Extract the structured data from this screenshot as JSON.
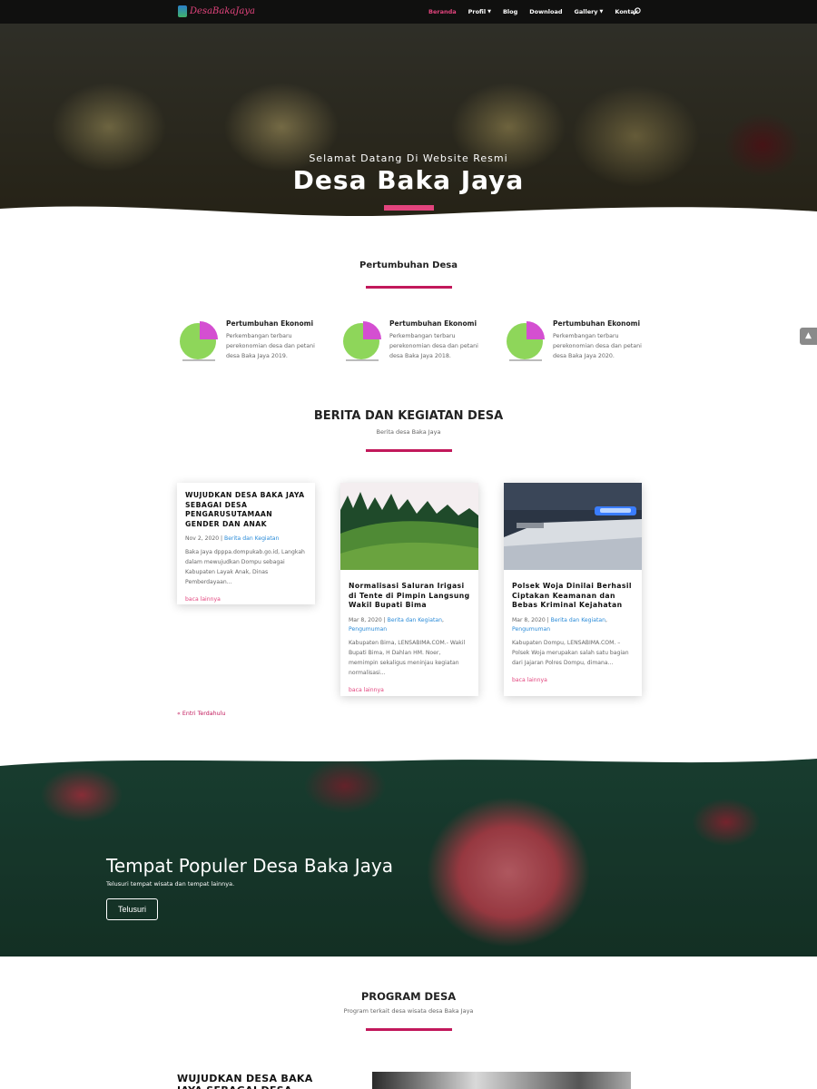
{
  "nav": {
    "logo": "DesaBakaJaya",
    "items": [
      {
        "label": "Beranda",
        "dropdown": false,
        "active": true
      },
      {
        "label": "Profil",
        "dropdown": true,
        "active": false
      },
      {
        "label": "Blog",
        "dropdown": false,
        "active": false
      },
      {
        "label": "Download",
        "dropdown": false,
        "active": false
      },
      {
        "label": "Gallery",
        "dropdown": true,
        "active": false
      },
      {
        "label": "Kontak",
        "dropdown": false,
        "active": false
      }
    ]
  },
  "hero": {
    "subtitle": "Selamat Datang Di Website Resmi",
    "title": "Desa Baka Jaya"
  },
  "growth_section": {
    "title": "Pertumbuhan Desa",
    "items": [
      {
        "title": "Pertumbuhan Ekonomi",
        "desc": "Perkembangan terbaru perekonomian desa dan petani desa Baka Jaya 2019."
      },
      {
        "title": "Pertumbuhan Ekonomi",
        "desc": "Perkembangan terbaru perekonomian desa dan petani desa Baka Jaya 2018."
      },
      {
        "title": "Pertumbuhan Ekonomi",
        "desc": "Perkembangan terbaru perekonomian desa dan petani desa Baka Jaya 2020."
      }
    ]
  },
  "news": {
    "title": "BERITA DAN KEGIATAN DESA",
    "subtitle": "Berita desa Baka Jaya",
    "posts": [
      {
        "title": "WUJUDKAN DESA BAKA JAYA SEBAGAI DESA PENGARUSUTAMAAN GENDER DAN ANAK",
        "date": "Nov 2, 2020",
        "categories": [
          "Berita dan Kegiatan"
        ],
        "excerpt": "Baka Jaya dpppa.dompukab.go.id, Langkah dalam mewujudkan Dompu sebagai Kabupaten Layak Anak, Dinas Pemberdayaan...",
        "more": "baca lainnya"
      },
      {
        "title": "Normalisasi Saluran Irigasi di Tente di Pimpin Langsung Wakil Bupati Bima",
        "date": "Mar 8, 2020",
        "categories": [
          "Berita dan Kegiatan",
          "Pengumuman"
        ],
        "excerpt": "Kabupaten Bima, LENSABIMA.COM.- Wakil Bupati Bima, H Dahlan HM. Noer, memimpin sekaligus meninjau kegiatan normalisasi...",
        "more": "baca lainnya"
      },
      {
        "title": "Polsek Woja Dinilai Berhasil Ciptakan Keamanan dan Bebas Kriminal Kejahatan",
        "date": "Mar 8, 2020",
        "categories": [
          "Berita dan Kegiatan",
          "Pengumuman"
        ],
        "excerpt": "Kabupaten Dompu, LENSABIMA.COM. – Polsek Woja merupakan salah satu bagian dari Jajaran Polres Dompu, dimana...",
        "more": "baca lainnya"
      }
    ],
    "older": "« Entri Terdahulu"
  },
  "banner": {
    "title": "Tempat Populer Desa Baka Jaya",
    "subtitle": "Telusuri tempat wisata dan tempat lainnya.",
    "button": "Telusuri"
  },
  "program": {
    "title": "PROGRAM DESA",
    "subtitle": "Program terkait desa wisata desa Baka Jaya",
    "first_post_title": "WUJUDKAN DESA BAKA JAYA SEBAGAI DESA"
  },
  "colors": {
    "accent": "#e2447d",
    "accent_line": "#c2185b",
    "link": "#2a8bd8",
    "pie_green": "#8ed65a",
    "pie_magenta": "#d44fd1"
  }
}
